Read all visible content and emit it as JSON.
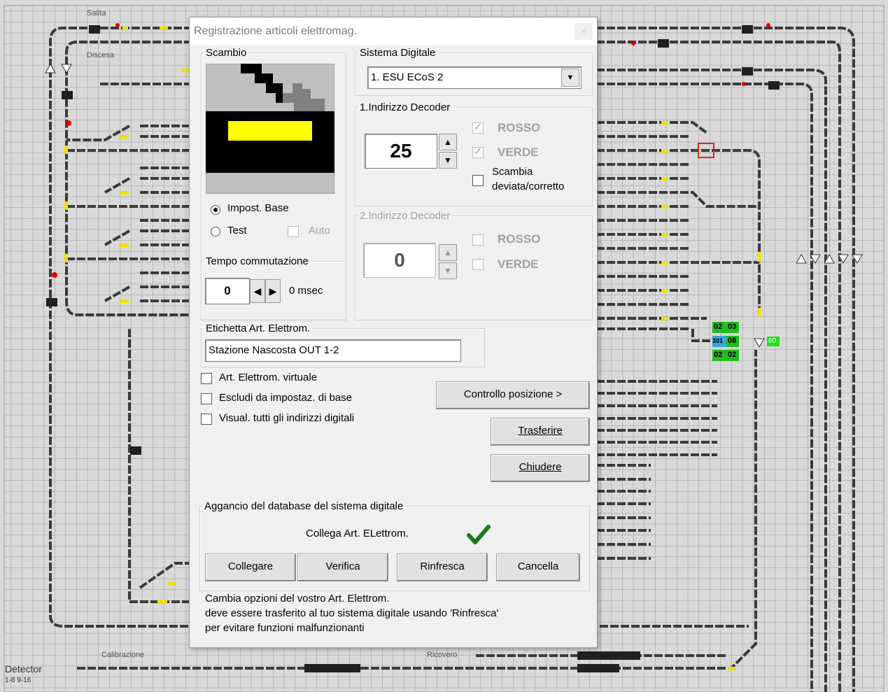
{
  "background": {
    "labels": {
      "salita": "Salita",
      "discesa": "Discesa",
      "calibrazione": "Calibrazione",
      "ricovero": "Ricovero",
      "detector": "Detector",
      "detector_range": "1-8 9-16"
    },
    "tags": {
      "r1a": "02",
      "r1b": "03",
      "r2a": "301",
      "r2b": "08",
      "r3a": "02",
      "r3b": "02",
      "signal": "60"
    }
  },
  "dialog": {
    "title": "Registrazione articoli elettromag.",
    "close": "×",
    "scambio": {
      "legend": "Scambio",
      "radio_base": "Impost. Base",
      "radio_test": "Test",
      "auto": "Auto"
    },
    "sistema": {
      "legend": "Sistema Digitale",
      "selected": "1. ESU ECoS 2"
    },
    "decoder1": {
      "legend": "1.Indirizzo Decoder",
      "value": "25",
      "rosso": "ROSSO",
      "verde": "VERDE",
      "scambia_1": "Scambia",
      "scambia_2": "deviata/corretto"
    },
    "decoder2": {
      "legend": "2.Indirizzo Decoder",
      "value": "0",
      "rosso": "ROSSO",
      "verde": "VERDE"
    },
    "tempo": {
      "legend": "Tempo commutazione",
      "value": "0",
      "unit": "0 msec"
    },
    "etichetta": {
      "legend": "Etichetta Art. Elettrom.",
      "value": "Stazione Nascosta OUT 1-2"
    },
    "options": {
      "virtuale": "Art. Elettrom. virtuale",
      "escludi": "Escludi da impostaz. di base",
      "visual": "Visual. tutti gli indirizzi digitali"
    },
    "buttons": {
      "controllo": "Controllo posizione >",
      "trasferire": "Trasferire",
      "chiudere": "Chiudere"
    },
    "aggancio": {
      "legend": "Aggancio del database del sistema digitale",
      "collega": "Collega Art. ELettrom.",
      "collegare": "Collegare",
      "verifica": "Verifica",
      "rinfresca": "Rinfresca",
      "cancella": "Cancella"
    },
    "note": {
      "line1": "Cambia opzioni del vostro Art. Elettrom.",
      "line2": "deve essere trasferito al tuo sistema digitale usando 'Rinfresca'",
      "line3": "per evitare funzioni malfunzionanti"
    }
  }
}
